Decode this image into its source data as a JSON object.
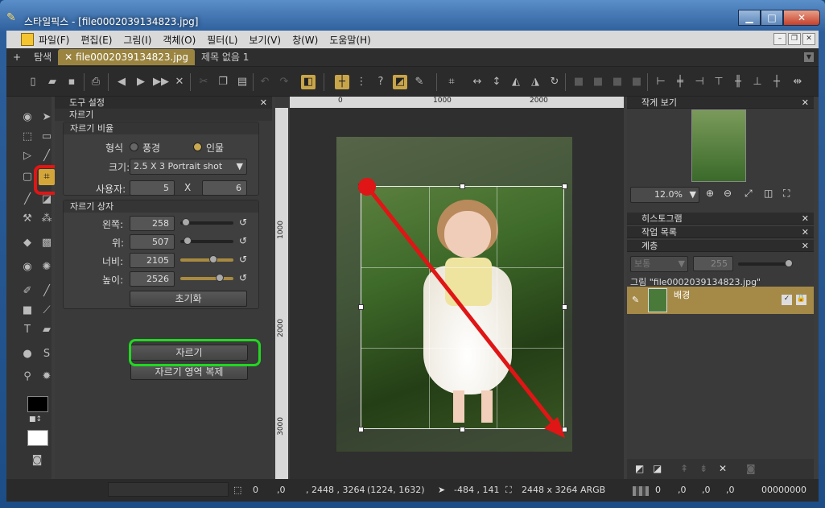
{
  "window": {
    "title": "스타일픽스 - [file0002039134823.jpg]"
  },
  "menu": [
    "파일(F)",
    "편집(E)",
    "그림(I)",
    "객체(O)",
    "필터(L)",
    "보기(V)",
    "창(W)",
    "도움말(H)"
  ],
  "tabs": {
    "add": "+",
    "explore": "탐색",
    "active": "file0002039134823.jpg",
    "other": "제목 없음 1"
  },
  "tool_panel": {
    "header": "도구 설정",
    "tool": "자르기",
    "ratio_group": "자르기 비율",
    "format_label": "형식",
    "landscape": "풍경",
    "portrait": "인물",
    "format_selected": "portrait",
    "size_label": "크기:",
    "size_value": "2.5 X 3 Portrait shot",
    "user_label": "사용자:",
    "user_w": "5",
    "user_x": "X",
    "user_h": "6",
    "box_group": "자르기 상자",
    "left_label": "왼쪽:",
    "left_value": "258",
    "top_label": "위:",
    "top_value": "507",
    "width_label": "너비:",
    "width_value": "2105",
    "height_label": "높이:",
    "height_value": "2526",
    "reset": "초기화",
    "crop_button": "자르기",
    "copy_button": "자르기 영역 복제"
  },
  "ruler": {
    "h": [
      "0",
      "1000",
      "2000"
    ],
    "v": [
      "1000",
      "2000",
      "3000"
    ]
  },
  "navigator": {
    "header": "작게 보기",
    "zoom": "12.0%"
  },
  "panels": {
    "histogram": "히스토그램",
    "history": "작업 목록",
    "layers": "계층"
  },
  "layers": {
    "blend": "보통",
    "opacity": "255",
    "group": "그림 \"file0002039134823.jpg\"",
    "layer_name": "배경"
  },
  "status": {
    "sel_x": "0",
    "sel_y": ",0",
    "size": ", 2448 , 3264",
    "center": "(1224, 1632)",
    "cursor": "-484 , 141",
    "dims": "2448 x 3264 ARGB",
    "c1": "0",
    "c2": ",0",
    "c3": ",0",
    "c4": ",0",
    "hex": "00000000"
  },
  "colors": {
    "highlight_red": "#e01515",
    "highlight_green": "#22d622",
    "accent": "#c9a54a"
  }
}
